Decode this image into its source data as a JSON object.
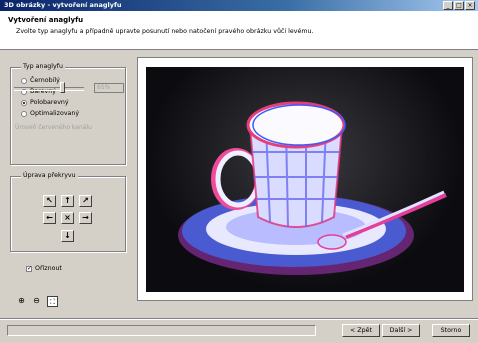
{
  "window": {
    "title": "3D obrázky - vytvoření anaglyfu",
    "min": "_",
    "max": "□",
    "close": "×"
  },
  "header": {
    "title": "Vytvoření anaglyfu",
    "subtitle": "Zvolte typ anaglyfu a případně upravte posunutí nebo natočení pravého obrázku vůči levému."
  },
  "type_group": {
    "legend": "Typ anaglyfu",
    "options": [
      {
        "label": "Černobílý",
        "selected": false
      },
      {
        "label": "Barevný",
        "selected": false
      },
      {
        "label": "Polobarevný",
        "selected": true
      },
      {
        "label": "Optimalizovaný",
        "selected": false
      }
    ],
    "intensity_label": "Úroveň červeného kanálu",
    "intensity_value": "65%"
  },
  "overlap_group": {
    "legend": "Úprava překryvu",
    "arrows": {
      "up_left": "↖",
      "up": "↑",
      "up_right": "↗",
      "left": "←",
      "center": "×",
      "right": "→",
      "down": "↓"
    }
  },
  "crop": {
    "label": "Oříznout",
    "checked": true,
    "check_glyph": "✓"
  },
  "zoom": {
    "zoom_in": "⊕",
    "zoom_out": "⊖",
    "fit": "⛶"
  },
  "buttons": {
    "back": "< Zpět",
    "next": "Další >",
    "cancel": "Storno"
  }
}
